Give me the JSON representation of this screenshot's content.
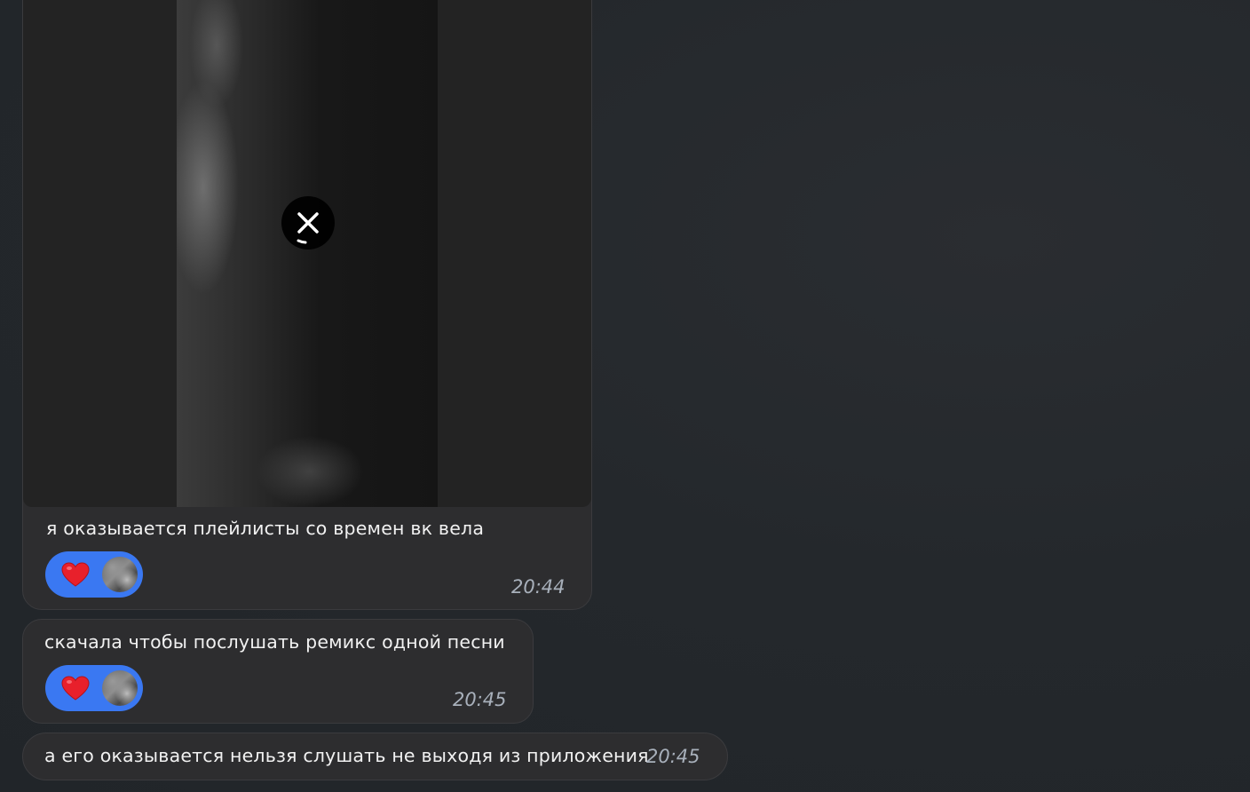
{
  "messages": [
    {
      "text": "я оказывается плейлисты со времен вк вела",
      "time": "20:44",
      "has_media": true,
      "media_state": "loading",
      "reaction": {
        "emoji": "heart-icon",
        "color": "#3a78f2"
      }
    },
    {
      "text": "скачала чтобы послушать ремикс одной песни",
      "time": "20:45",
      "reaction": {
        "emoji": "heart-icon",
        "color": "#3a78f2"
      }
    },
    {
      "text": "а его оказывается нельзя слушать не выходя из приложения",
      "time": "20:45"
    }
  ],
  "icons": {
    "media_cancel": "close-icon",
    "reaction": "heart-icon",
    "reactor": "avatar"
  }
}
